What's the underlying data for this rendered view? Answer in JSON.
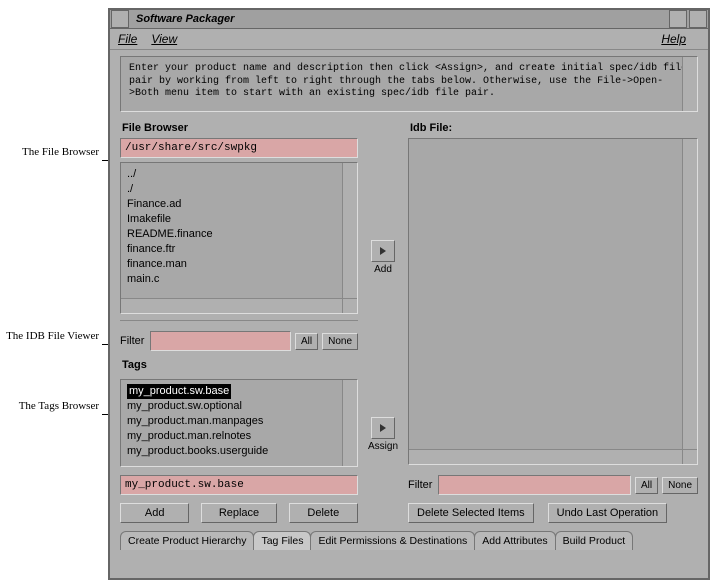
{
  "window": {
    "title": "Software Packager"
  },
  "menu": {
    "file": "File",
    "view": "View",
    "help": "Help"
  },
  "instruction": "Enter your product name and description then click <Assign>, and create initial spec/idb file pair by working from left to right through the tabs below.  Otherwise, use the File->Open->Both menu item to start with an existing spec/idb file pair.",
  "annotations": {
    "file_browser": "The File Browser",
    "idb_viewer": "The IDB File Viewer",
    "tags_browser": "The Tags Browser"
  },
  "file_browser": {
    "label": "File Browser",
    "path": "/usr/share/src/swpkg",
    "items": [
      "../",
      "./",
      "Finance.ad",
      "Imakefile",
      "README.finance",
      "finance.ftr",
      "finance.man",
      "main.c"
    ],
    "filter_label": "Filter",
    "filter_value": "",
    "all": "All",
    "none": "None"
  },
  "mid": {
    "add": "Add",
    "assign": "Assign"
  },
  "tags": {
    "label": "Tags",
    "items": [
      "my_product.sw.base",
      "my_product.sw.optional",
      "my_product.man.manpages",
      "my_product.man.relnotes",
      "my_product.books.userguide"
    ],
    "selected": "my_product.sw.base",
    "add": "Add",
    "replace": "Replace",
    "delete": "Delete"
  },
  "idb": {
    "label": "Idb File:",
    "filter_label": "Filter",
    "filter_value": "",
    "all": "All",
    "none": "None",
    "delete_sel": "Delete Selected Items",
    "undo": "Undo Last Operation"
  },
  "tabs": {
    "t1": "Create Product Hierarchy",
    "t2": "Tag Files",
    "t3": "Edit Permissions & Destinations",
    "t4": "Add Attributes",
    "t5": "Build Product"
  }
}
